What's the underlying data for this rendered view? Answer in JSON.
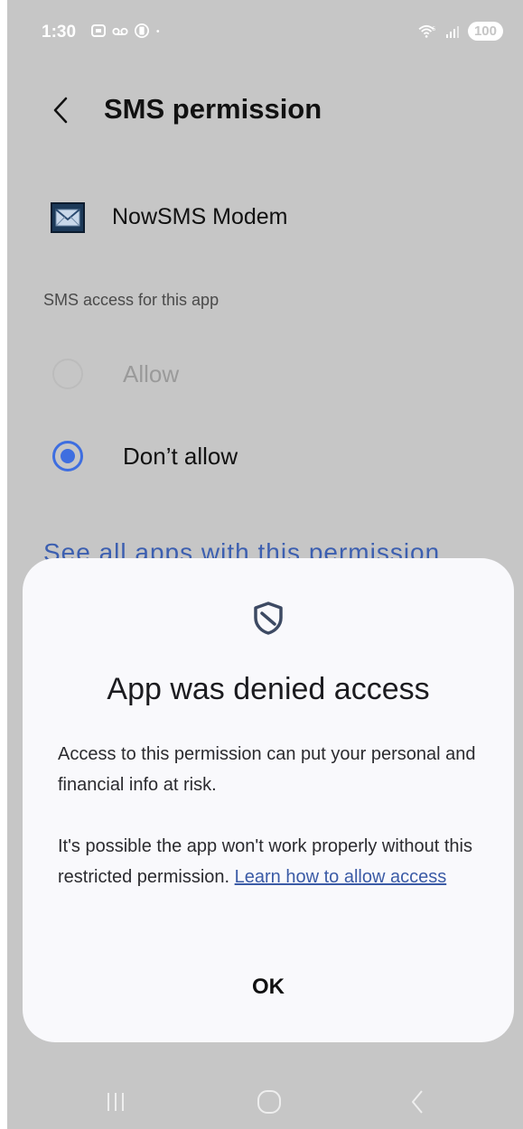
{
  "status_bar": {
    "time": "1:30",
    "battery": "100",
    "icons_left": [
      "screenshot-icon",
      "voicemail-icon",
      "vibrate-icon",
      "dot-icon"
    ],
    "icons_right": [
      "wifi-icon",
      "signal-icon"
    ]
  },
  "header": {
    "title": "SMS permission"
  },
  "app": {
    "name": "NowSMS Modem",
    "icon": "envelope-icon"
  },
  "permission": {
    "section_label": "SMS access for this app",
    "options": [
      {
        "label": "Allow",
        "selected": false,
        "enabled": false
      },
      {
        "label": "Don’t allow",
        "selected": true,
        "enabled": true
      }
    ],
    "see_all_link": "See all apps with this permission"
  },
  "dialog": {
    "icon": "shield-icon",
    "title": "App was denied access",
    "paragraph1": "Access to this permission can put your personal and financial info at risk.",
    "paragraph2": "It's possible the app won't work properly without this restricted permission.",
    "link": "Learn how to allow access",
    "ok_label": "OK"
  },
  "nav_bar": {
    "items": [
      "recents-icon",
      "home-icon",
      "back-icon"
    ]
  },
  "colors": {
    "scrim_background": "#c6c6c6",
    "dialog_background": "#f9f9fc",
    "accent_blue": "#3e6ee0",
    "link_blue": "#3b5ba6"
  }
}
